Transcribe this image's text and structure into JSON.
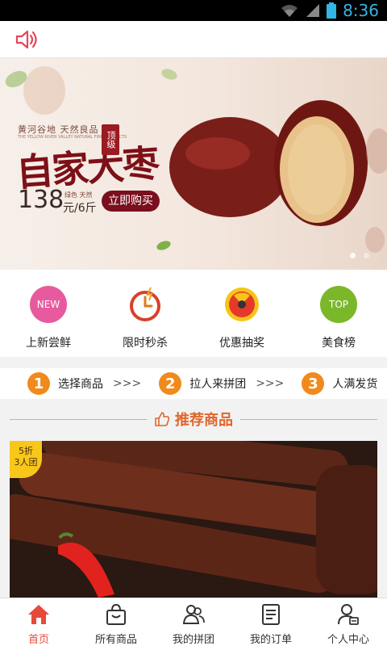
{
  "status_bar": {
    "time": "8:36",
    "icons": [
      "wifi-icon",
      "signal-icon",
      "battery-icon"
    ]
  },
  "top_bar": {
    "icon": "speaker-icon"
  },
  "banner": {
    "tagline": "黄河谷地  天然良品",
    "subline": "THE YELLOW RIVER VALLEY NATURAL FINE PRODUCTS",
    "badge": "顶级",
    "headline": "自家大枣",
    "price": "138",
    "price_unit": "元/6斤",
    "price_note": "绿色 天然",
    "buy_label": "立即购买",
    "active_slide": 0
  },
  "quick_links": [
    {
      "label": "上新尝鲜",
      "icon_text": "NEW",
      "icon": "new-icon",
      "color": "#e85a9e"
    },
    {
      "label": "限时秒杀",
      "icon_text": "",
      "icon": "alarm-clock-icon",
      "color": "#d9402a"
    },
    {
      "label": "优惠抽奖",
      "icon_text": "",
      "icon": "lottery-wheel-icon",
      "color": "#e8382a"
    },
    {
      "label": "美食榜",
      "icon_text": "TOP",
      "icon": "top-icon",
      "color": "#7ab82a"
    }
  ],
  "steps": [
    {
      "num": "1",
      "text": "选择商品",
      "arrow": ">>>"
    },
    {
      "num": "2",
      "text": "拉人来拼团",
      "arrow": ">>>"
    },
    {
      "num": "3",
      "text": "人满发货",
      "arrow": ""
    }
  ],
  "recommend": {
    "title": "推荐商品",
    "icon": "thumbs-up-icon"
  },
  "product": {
    "tag_line1": "5折",
    "tag_line2": "3人团"
  },
  "tabs": [
    {
      "label": "首页",
      "icon": "home-icon",
      "active": true
    },
    {
      "label": "所有商品",
      "icon": "shopping-bag-icon",
      "active": false
    },
    {
      "label": "我的拼团",
      "icon": "group-users-icon",
      "active": false
    },
    {
      "label": "我的订单",
      "icon": "order-list-icon",
      "active": false
    },
    {
      "label": "个人中心",
      "icon": "user-profile-icon",
      "active": false
    }
  ],
  "colors": {
    "accent": "#e84a3a",
    "step_orange": "#f08a1c",
    "recommend_orange": "#e0662a",
    "banner_red": "#7a0f1d"
  }
}
